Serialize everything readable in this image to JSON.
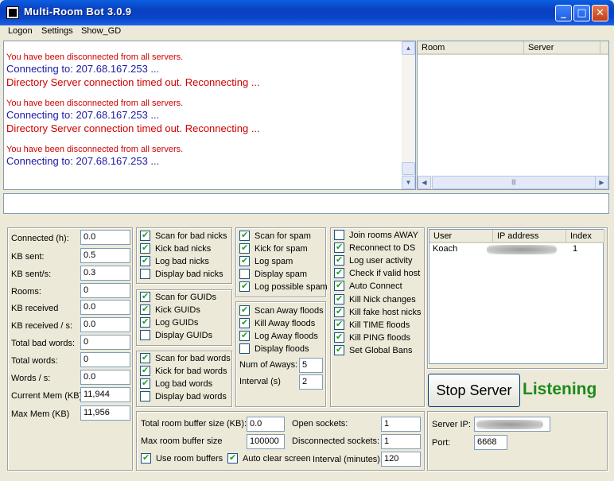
{
  "window": {
    "title": "Multi-Room Bot 3.0.9",
    "controls": [
      "_",
      "□",
      "✕"
    ]
  },
  "menu": [
    "Logon",
    "Settings",
    "Show_GD"
  ],
  "log": [
    {
      "text": "You have been disconnected from all servers.",
      "style": "red-small"
    },
    {
      "text": "Connecting to: 207.68.167.253 ...",
      "style": "blue-big"
    },
    {
      "text": "Directory Server connection timed out. Reconnecting ...",
      "style": "red-big"
    },
    {
      "text": "You have been disconnected from all servers.",
      "style": "red-small"
    },
    {
      "text": "Connecting to: 207.68.167.253 ...",
      "style": "blue-big"
    },
    {
      "text": "Directory Server connection timed out. Reconnecting ...",
      "style": "red-big"
    },
    {
      "text": "You have been disconnected from all servers.",
      "style": "red-small"
    },
    {
      "text": "Connecting to: 207.68.167.253 ...",
      "style": "blue-big"
    }
  ],
  "room_list": {
    "columns": [
      "Room",
      "Server"
    ]
  },
  "command_input": {
    "value": ""
  },
  "stats": [
    {
      "label": "Connected (h):",
      "value": "0.0"
    },
    {
      "label": "KB sent:",
      "value": "0.5"
    },
    {
      "label": "KB sent/s:",
      "value": "0.3"
    },
    {
      "label": "Rooms:",
      "value": "0"
    },
    {
      "label": "KB received",
      "value": "0.0"
    },
    {
      "label": "KB received / s:",
      "value": "0.0"
    },
    {
      "label": "Total bad words:",
      "value": "0"
    },
    {
      "label": "Total words:",
      "value": "0"
    },
    {
      "label": "Words / s:",
      "value": "0.0"
    },
    {
      "label": "Current Mem (KB)",
      "value": "11,944"
    },
    {
      "label": "Max Mem (KB)",
      "value": "11,956"
    }
  ],
  "nick_group": [
    {
      "label": "Scan for bad nicks",
      "checked": true
    },
    {
      "label": "Kick bad nicks",
      "checked": true
    },
    {
      "label": "Log bad nicks",
      "checked": true
    },
    {
      "label": "Display bad nicks",
      "checked": false
    }
  ],
  "guid_group": [
    {
      "label": "Scan for GUIDs",
      "checked": true
    },
    {
      "label": "Kick GUIDs",
      "checked": true
    },
    {
      "label": "Log GUIDs",
      "checked": true
    },
    {
      "label": "Display GUIDs",
      "checked": false
    }
  ],
  "words_group": [
    {
      "label": "Scan for bad words",
      "checked": true
    },
    {
      "label": "Kick for bad words",
      "checked": true
    },
    {
      "label": "Log bad words",
      "checked": true
    },
    {
      "label": "Display bad words",
      "checked": false
    }
  ],
  "spam_group": [
    {
      "label": "Scan for spam",
      "checked": true
    },
    {
      "label": "Kick for spam",
      "checked": true
    },
    {
      "label": "Log spam",
      "checked": true
    },
    {
      "label": "Display spam",
      "checked": false
    },
    {
      "label": "Log possible spam",
      "checked": true
    }
  ],
  "away_group": {
    "checks": [
      {
        "label": "Scan Away floods",
        "checked": true
      },
      {
        "label": "Kill Away floods",
        "checked": true
      },
      {
        "label": "Log Away floods",
        "checked": true
      },
      {
        "label": "Display floods",
        "checked": false
      }
    ],
    "num_aways_label": "Num of Aways:",
    "num_aways_value": "5",
    "interval_label": "Interval (s)",
    "interval_value": "2"
  },
  "options_group": [
    {
      "label": "Join rooms AWAY",
      "checked": false
    },
    {
      "label": "Reconnect to DS",
      "checked": true
    },
    {
      "label": "Log user activity",
      "checked": true
    },
    {
      "label": "Check if valid host",
      "checked": true
    },
    {
      "label": "Auto Connect",
      "checked": true
    },
    {
      "label": "Kill Nick changes",
      "checked": true
    },
    {
      "label": "Kill fake host nicks",
      "checked": true
    },
    {
      "label": "Kill TIME floods",
      "checked": true
    },
    {
      "label": "Kill PING floods",
      "checked": true
    },
    {
      "label": "Set Global Bans",
      "checked": true
    }
  ],
  "user_list": {
    "columns": [
      "User",
      "IP address",
      "Index"
    ],
    "rows": [
      {
        "user": "Koach",
        "index": "1"
      }
    ]
  },
  "server_control": {
    "stop_label": "Stop Server",
    "status": "Listening",
    "status_color": "#1b8a1b"
  },
  "buffers": {
    "total_label": "Total room buffer size (KB):",
    "total_value": "0.0",
    "max_label": "Max room buffer size",
    "max_value": "100000",
    "use_label": "Use room buffers",
    "use_checked": true,
    "open_sockets_label": "Open sockets:",
    "open_sockets_value": "1",
    "disconnected_label": "Disconnected sockets:",
    "disconnected_value": "1",
    "auto_clear_label": "Auto clear screen",
    "auto_clear_checked": true,
    "interval_label": "Interval (minutes):",
    "interval_value": "120"
  },
  "server": {
    "ip_label": "Server IP:",
    "port_label": "Port:",
    "port_value": "6668"
  }
}
